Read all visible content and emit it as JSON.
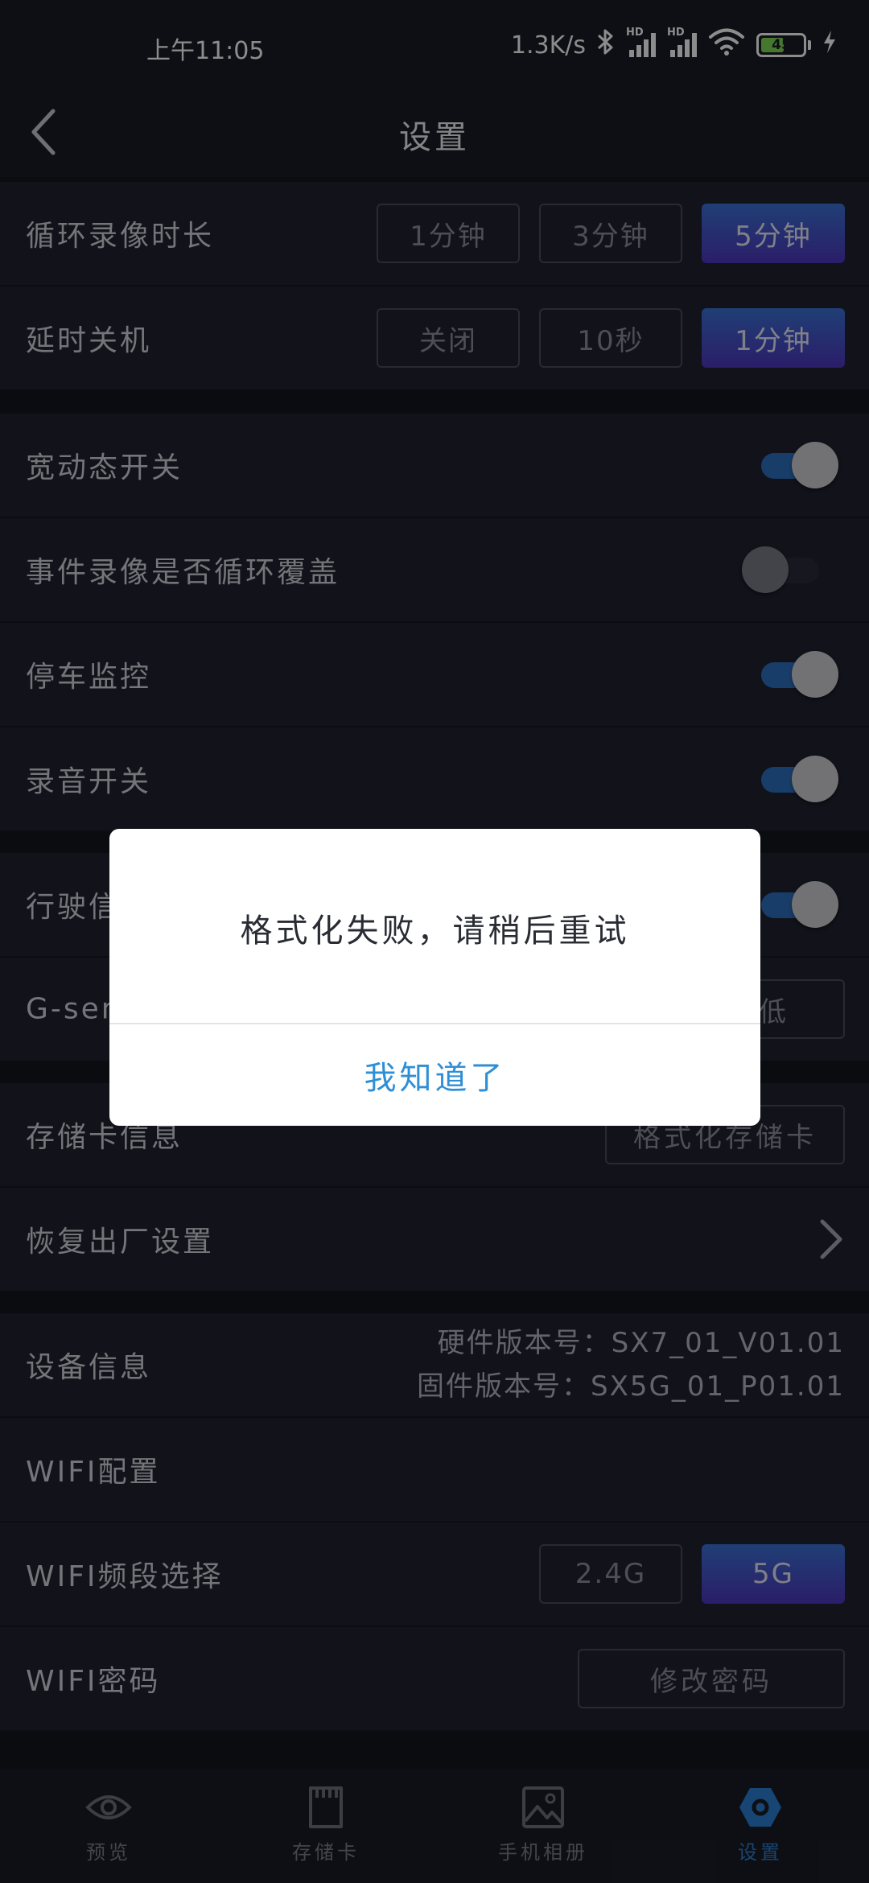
{
  "status_bar": {
    "time": "上午11:05",
    "net_speed": "1.3K/s",
    "signal_tag": "HD",
    "battery": "45",
    "icons": [
      "bluetooth-icon",
      "signal-icon",
      "signal-icon",
      "wifi-icon",
      "battery-icon",
      "charging-icon"
    ]
  },
  "header": {
    "title": "设置",
    "back_icon": "chevron-left-icon"
  },
  "loop_record": {
    "label": "循环录像时长",
    "options": [
      "1分钟",
      "3分钟",
      "5分钟"
    ],
    "selected": "5分钟"
  },
  "delay_shutdown": {
    "label": "延时关机",
    "options": [
      "关闭",
      "10秒",
      "1分钟"
    ],
    "selected": "1分钟"
  },
  "wdr": {
    "label": "宽动态开关",
    "on": true
  },
  "event_loop_overwrite": {
    "label": "事件录像是否循环覆盖",
    "on": false
  },
  "parking_monitor": {
    "label": "停车监控",
    "on": true
  },
  "audio": {
    "label": "录音开关",
    "on": true
  },
  "driving_info": {
    "label": "行驶信",
    "on": true
  },
  "gsensor": {
    "label": "G-sens",
    "visible_option": "低"
  },
  "storage_card": {
    "label": "存储卡信息",
    "button": "格式化存储卡"
  },
  "factory_reset": {
    "label": "恢复出厂设置"
  },
  "device_info": {
    "label": "设备信息",
    "hardware": "硬件版本号：SX7_01_V01.01",
    "firmware": "固件版本号：SX5G_01_P01.01"
  },
  "wifi_config": {
    "label": "WIFI配置"
  },
  "wifi_band": {
    "label": "WIFI频段选择",
    "options": [
      "2.4G",
      "5G"
    ],
    "selected": "5G"
  },
  "wifi_password": {
    "label": "WIFI密码",
    "button": "修改密码"
  },
  "tabs": [
    {
      "label": "预览",
      "icon": "eye-icon",
      "active": false
    },
    {
      "label": "存储卡",
      "icon": "sd-card-icon",
      "active": false
    },
    {
      "label": "手机相册",
      "icon": "image-icon",
      "active": false
    },
    {
      "label": "设置",
      "icon": "gear-icon",
      "active": true
    }
  ],
  "dialog": {
    "message": "格式化失败，请稍后重试",
    "confirm": "我知道了"
  },
  "colors": {
    "accent": "#2a7fd4",
    "toggle_on": "#2d6fbf",
    "row_bg": "#1f2230",
    "page_bg": "#15171e"
  }
}
